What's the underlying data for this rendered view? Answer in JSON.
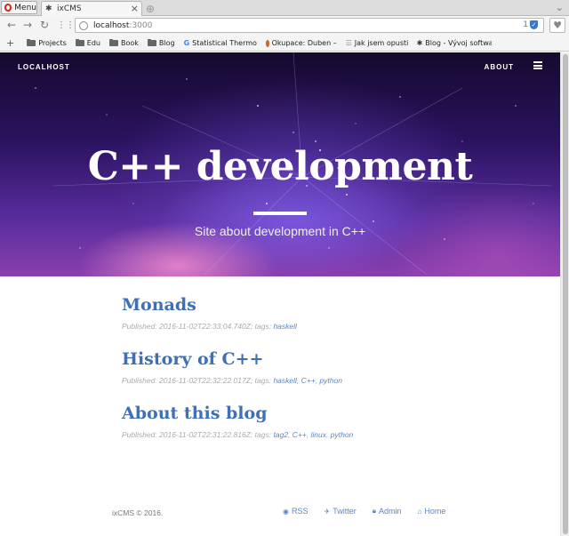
{
  "browser": {
    "menu_label": "Menu",
    "tab_title": "ixCMS",
    "url_host": "localhost",
    "url_port": ":3000",
    "url_badge_count": "1",
    "bookmarks": [
      {
        "label": "Projects",
        "icon": "folder-icon"
      },
      {
        "label": "Edu",
        "icon": "folder-icon"
      },
      {
        "label": "Book",
        "icon": "folder-icon"
      },
      {
        "label": "Blog",
        "icon": "folder-icon"
      },
      {
        "label": "Statistical Thermo",
        "icon": "google-icon"
      },
      {
        "label": "Okupace: Duben –",
        "icon": "opera-icon"
      },
      {
        "label": "Jak jsem opustil ...",
        "icon": "page-icon"
      },
      {
        "label": "Blog - Vývoj softwa",
        "icon": "bug-icon"
      }
    ]
  },
  "site": {
    "brand": "LOCALHOST",
    "nav_about": "ABOUT",
    "hero_title": "C++ development",
    "hero_subtitle": "Site about development in C++"
  },
  "posts": [
    {
      "title": "Monads",
      "published_prefix": "Published: 2016-11-02T22:33:04.740Z; tags: ",
      "tags": [
        "haskell"
      ]
    },
    {
      "title": "History of C++",
      "published_prefix": "Published: 2016-11-02T22:32:22.017Z; tags: ",
      "tags": [
        "haskell",
        "C++",
        "python"
      ]
    },
    {
      "title": "About this blog",
      "published_prefix": "Published: 2016-11-02T22:31:22.816Z; tags: ",
      "tags": [
        "tag2",
        "C++",
        "linux",
        "python"
      ]
    }
  ],
  "footer": {
    "copyright": "ixCMS © 2016.",
    "links": {
      "rss": "RSS",
      "twitter": "Twitter",
      "admin": "Admin",
      "home": "Home"
    }
  },
  "colors": {
    "link": "#3f6fb4",
    "hero_dark": "#150a2e",
    "hero_purple": "#5a2d9e"
  }
}
